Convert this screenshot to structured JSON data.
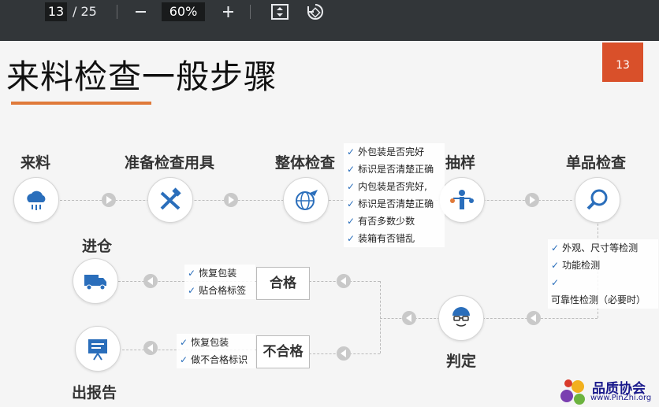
{
  "toolbar": {
    "page_current": "13",
    "page_total": "/ 25",
    "zoom": "60%",
    "icons": [
      "minus-icon",
      "plus-icon",
      "fit-page-icon",
      "rotate-icon"
    ]
  },
  "slide": {
    "title": "来料检查一般步骤",
    "page_badge": "13",
    "steps": {
      "s1": "来料",
      "s2": "准备检查用具",
      "s3": "整体检查",
      "s4": "抽样",
      "s5": "单品检查",
      "judge": "判定",
      "store": "进仓",
      "report": "出报告"
    },
    "overall_checks": [
      "外包装是否完好",
      "标识是否清楚正确",
      "内包装是否完好,",
      "标识是否清楚正确",
      "有否多数少数",
      "装箱有否错乱"
    ],
    "unit_checks": [
      "外观、尺寸等检测",
      "功能检测",
      "可靠性检测（必要时）"
    ],
    "pass_box": "合格",
    "fail_box": "不合格",
    "pass_actions": [
      "恢复包装",
      "贴合格标签"
    ],
    "fail_actions": [
      "恢复包装",
      "做不合格标识"
    ],
    "check_mark": "✓",
    "logo_name": "品质协会",
    "logo_url": "www.PinZhi.org"
  },
  "colors": {
    "accent": "#e07a3a",
    "badge": "#d9502a",
    "icon_blue": "#2a6ebb",
    "toolbar": "#323639"
  }
}
